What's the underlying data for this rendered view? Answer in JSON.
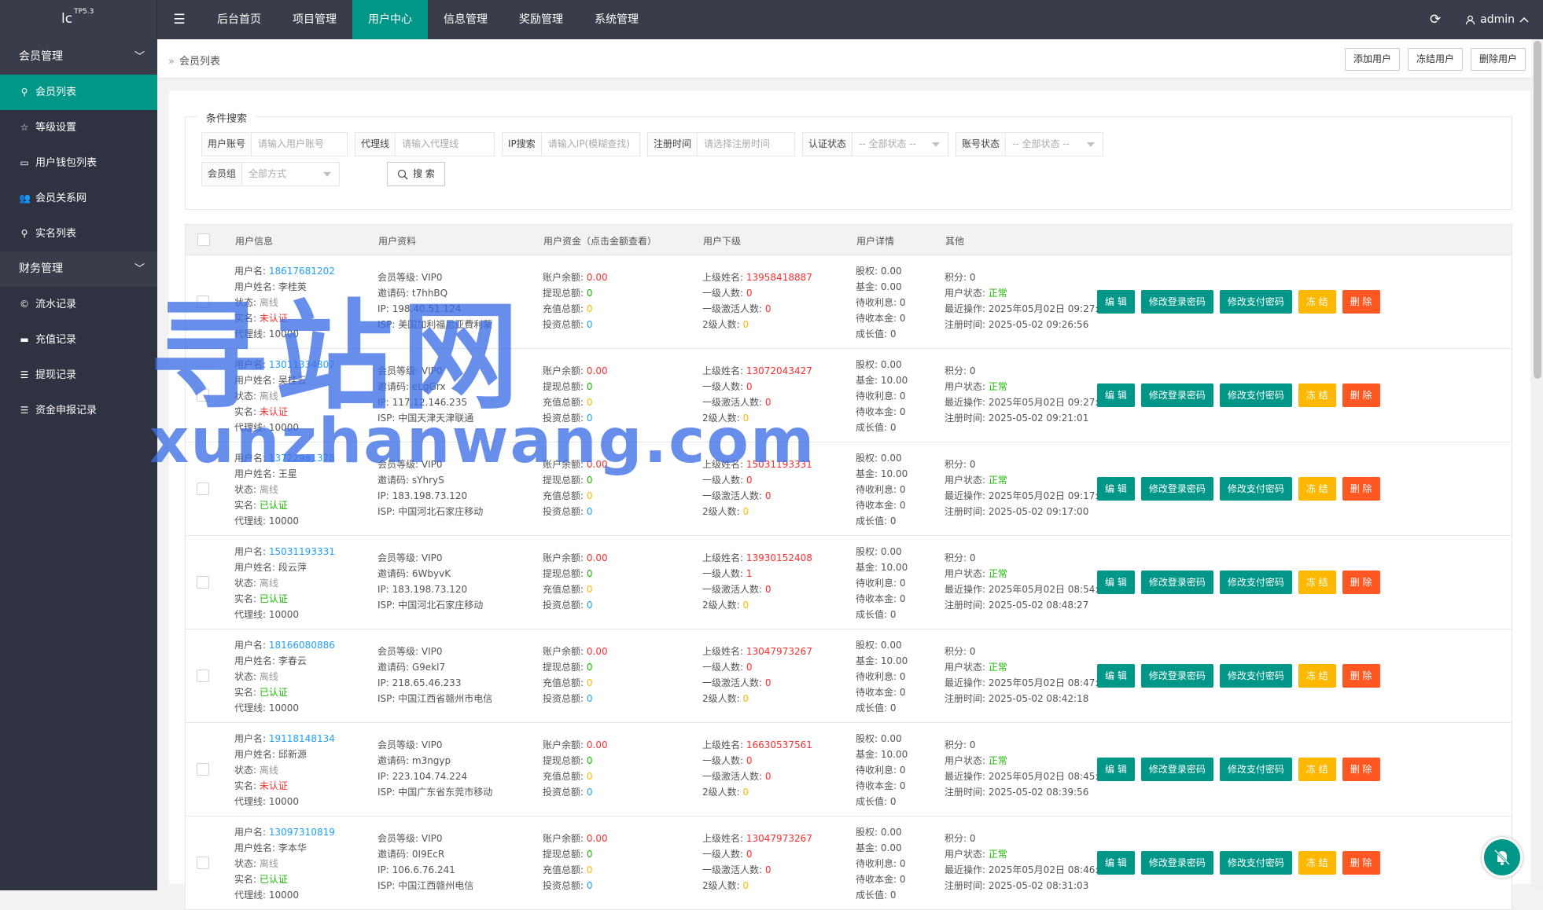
{
  "app": {
    "logo": "lc",
    "version": "TP5.3"
  },
  "topnav": [
    "后台首页",
    "项目管理",
    "用户中心",
    "信息管理",
    "奖励管理",
    "系统管理"
  ],
  "admin_name": "admin",
  "sidebar": {
    "group1": "会员管理",
    "items1": [
      {
        "label": "会员列表",
        "icon": "user-icon"
      },
      {
        "label": "等级设置",
        "icon": "star-icon"
      },
      {
        "label": "用户钱包列表",
        "icon": "card-icon"
      },
      {
        "label": "会员关系网",
        "icon": "users-icon"
      },
      {
        "label": "实名列表",
        "icon": "user-icon"
      }
    ],
    "group2": "财务管理",
    "items2": [
      {
        "label": "流水记录",
        "icon": "copyright-icon"
      },
      {
        "label": "充值记录",
        "icon": "card-icon"
      },
      {
        "label": "提现记录",
        "icon": "list-icon"
      },
      {
        "label": "资金申报记录",
        "icon": "list-icon"
      }
    ]
  },
  "breadcrumb": "会员列表",
  "header_buttons": [
    "添加用户",
    "冻结用户",
    "删除用户"
  ],
  "search": {
    "legend": "条件搜索",
    "fields": [
      {
        "label": "用户账号",
        "placeholder": "请输入用户账号"
      },
      {
        "label": "代理线",
        "placeholder": "请输入代理线"
      },
      {
        "label": "IP搜索",
        "placeholder": "请输入IP(模糊查找)"
      },
      {
        "label": "注册时间",
        "placeholder": "请选择注册时间"
      },
      {
        "label": "认证状态",
        "placeholder": "-- 全部状态 --"
      },
      {
        "label": "账号状态",
        "placeholder": "-- 全部状态 --"
      },
      {
        "label": "会员组",
        "placeholder": "全部方式"
      }
    ],
    "button": "搜 索"
  },
  "table_headers": [
    "用户信息",
    "用户资料",
    "用户资金（点击金额查看）",
    "用户下级",
    "用户详情",
    "其他"
  ],
  "labels": {
    "username": "用户名:",
    "realname_name": "用户姓名:",
    "status": "状态:",
    "realname": "实名:",
    "agent": "代理线:",
    "level": "会员等级:",
    "invite": "邀请码:",
    "ip": "IP:",
    "isp": "ISP:",
    "balance": "账户余额:",
    "withdraw": "提现总额:",
    "recharge": "充值总额:",
    "invest": "投资总额:",
    "parent": "上级姓名:",
    "lv1": "一级人数:",
    "lv1active": "一级激活人数:",
    "lv2": "2级人数:",
    "stock": "股权:",
    "fund": "基金:",
    "interest": "待收利息:",
    "principal": "待收本金:",
    "growth": "成长值:",
    "points": "积分:",
    "ustatus": "用户状态:",
    "lastop": "最近操作:",
    "regtime": "注册时间:"
  },
  "actions": [
    "编 辑",
    "修改登录密码",
    "修改支付密码",
    "冻 结",
    "删 除"
  ],
  "rows": [
    {
      "username": "18617681202",
      "name": "李桂英",
      "status": "离线",
      "realname": "未认证",
      "agent": "10000",
      "level": "VIP0",
      "invite": "t7hhBQ",
      "ip": "198.40.51.124",
      "isp": "美国加利福尼亚費利蒙",
      "balance": "0.00",
      "withdraw": "0",
      "recharge": "0",
      "invest": "0",
      "parent": "13958418887",
      "lv1": "0",
      "lv1active": "0",
      "lv2": "0",
      "stock": "0.00",
      "fund": "0.00",
      "interest": "0",
      "principal": "0",
      "growth": "0",
      "points": "0",
      "ustatus": "正常",
      "lastop": "2025年05月02日 09:27:27",
      "regtime": "2025-05-02 09:26:56"
    },
    {
      "username": "13011334807",
      "name": "吴桂云",
      "status": "离线",
      "realname": "未认证",
      "agent": "10000",
      "level": "VIP0",
      "invite": "eLgGrx",
      "ip": "117.12.146.235",
      "isp": "中国天津天津联通",
      "balance": "0.00",
      "withdraw": "0",
      "recharge": "0",
      "invest": "0",
      "parent": "13072043427",
      "lv1": "0",
      "lv1active": "0",
      "lv2": "0",
      "stock": "0.00",
      "fund": "10.00",
      "interest": "0",
      "principal": "0",
      "growth": "0",
      "points": "0",
      "ustatus": "正常",
      "lastop": "2025年05月02日 09:27:51",
      "regtime": "2025-05-02 09:21:01"
    },
    {
      "username": "13722981378",
      "name": "王星",
      "status": "离线",
      "realname": "已认证",
      "agent": "10000",
      "level": "VIP0",
      "invite": "sYhryS",
      "ip": "183.198.73.120",
      "isp": "中国河北石家庄移动",
      "balance": "0.00",
      "withdraw": "0",
      "recharge": "0",
      "invest": "0",
      "parent": "15031193331",
      "lv1": "0",
      "lv1active": "0",
      "lv2": "0",
      "stock": "0.00",
      "fund": "10.00",
      "interest": "0",
      "principal": "0",
      "growth": "0",
      "points": "0",
      "ustatus": "正常",
      "lastop": "2025年05月02日 09:17:53",
      "regtime": "2025-05-02 09:17:00"
    },
    {
      "username": "15031193331",
      "name": "段云萍",
      "status": "离线",
      "realname": "已认证",
      "agent": "10000",
      "level": "VIP0",
      "invite": "6WbyvK",
      "ip": "183.198.73.120",
      "isp": "中国河北石家庄移动",
      "balance": "0.00",
      "withdraw": "0",
      "recharge": "0",
      "invest": "0",
      "parent": "13930152408",
      "lv1": "1",
      "lv1active": "0",
      "lv2": "0",
      "stock": "0.00",
      "fund": "10.00",
      "interest": "0",
      "principal": "0",
      "growth": "0",
      "points": "0",
      "ustatus": "正常",
      "lastop": "2025年05月02日 08:54:45",
      "regtime": "2025-05-02 08:48:27"
    },
    {
      "username": "18166080886",
      "name": "李春云",
      "status": "离线",
      "realname": "已认证",
      "agent": "10000",
      "level": "VIP0",
      "invite": "G9ekl7",
      "ip": "218.65.46.233",
      "isp": "中国江西省赣州市电信",
      "balance": "0.00",
      "withdraw": "0",
      "recharge": "0",
      "invest": "0",
      "parent": "13047973267",
      "lv1": "0",
      "lv1active": "0",
      "lv2": "0",
      "stock": "0.00",
      "fund": "10.00",
      "interest": "0",
      "principal": "0",
      "growth": "0",
      "points": "0",
      "ustatus": "正常",
      "lastop": "2025年05月02日 08:47:20",
      "regtime": "2025-05-02 08:42:18"
    },
    {
      "username": "19118148134",
      "name": "邱新源",
      "status": "离线",
      "realname": "未认证",
      "agent": "10000",
      "level": "VIP0",
      "invite": "m3ngyp",
      "ip": "223.104.74.224",
      "isp": "中国广东省东莞市移动",
      "balance": "0.00",
      "withdraw": "0",
      "recharge": "0",
      "invest": "0",
      "parent": "16630537561",
      "lv1": "0",
      "lv1active": "0",
      "lv2": "0",
      "stock": "0.00",
      "fund": "10.00",
      "interest": "0",
      "principal": "0",
      "growth": "0",
      "points": "0",
      "ustatus": "正常",
      "lastop": "2025年05月02日 08:45:20",
      "regtime": "2025-05-02 08:39:56"
    },
    {
      "username": "13097310819",
      "name": "李本华",
      "status": "离线",
      "realname": "已认证",
      "agent": "10000",
      "level": "VIP0",
      "invite": "0I9EcR",
      "ip": "106.6.76.241",
      "isp": "中国江西赣州电信",
      "balance": "0.00",
      "withdraw": "0",
      "recharge": "0",
      "invest": "0",
      "parent": "13047973267",
      "lv1": "0",
      "lv1active": "0",
      "lv2": "0",
      "stock": "0.00",
      "fund": "0.00",
      "interest": "0",
      "principal": "0",
      "growth": "0",
      "points": "0",
      "ustatus": "正常",
      "lastop": "2025年05月02日 08:46:55",
      "regtime": "2025-05-02 08:31:03"
    }
  ],
  "watermark": {
    "line1": "寻站网",
    "line2": "xunzhanwang.com"
  },
  "colors": {
    "teal": "#009688",
    "topbar": "#393d49",
    "sidebar": "#2f3240",
    "orange": "#ffb800",
    "red": "#ff5722",
    "blue": "#1e9fff"
  }
}
